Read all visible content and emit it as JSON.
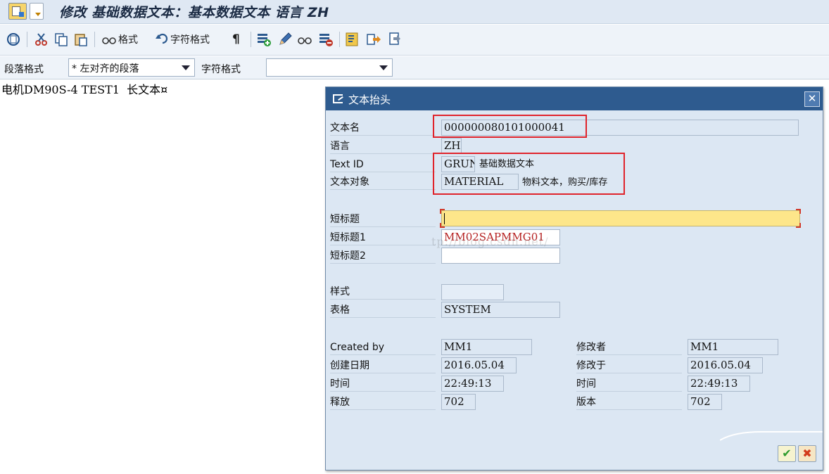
{
  "title": "修改 基础数据文本：基本数据文本 语言 ZH",
  "toolbar": {
    "format_label": "格式",
    "char_format_label": "字符格式",
    "paragraph_mark": "¶"
  },
  "formatbar": {
    "paragraph_label": "段落格式",
    "paragraph_value": "* 左对齐的段落",
    "char_label": "字符格式",
    "char_value": ""
  },
  "editor": {
    "line1": "电机DM90S-4 TEST1  长文本¤"
  },
  "dialog": {
    "title": "文本抬头",
    "close": "✕",
    "fields": {
      "text_name_label": "文本名",
      "text_name_value": "000000080101000041",
      "language_label": "语言",
      "language_value": "ZH",
      "text_id_label": "Text ID",
      "text_id_value": "GRUN",
      "text_id_desc": "基础数据文本",
      "text_object_label": "文本对象",
      "text_object_value": "MATERIAL",
      "text_object_desc": "物料文本，购买/库存",
      "short_title_label": "短标题",
      "short_title_value": "",
      "short_title1_label": "短标题1",
      "short_title1_value": "MM02SAPMMG01",
      "short_title2_label": "短标题2",
      "short_title2_value": "",
      "style_label": "样式",
      "style_value": "",
      "form_label": "表格",
      "form_value": "SYSTEM",
      "created_by_label": "Created by",
      "created_by_value": "MM1",
      "created_date_label": "创建日期",
      "created_date_value": "2016.05.04",
      "created_time_label": "时间",
      "created_time_value": "22:49:13",
      "release_label": "释放",
      "release_value": "702",
      "changed_by_label": "修改者",
      "changed_by_value": "MM1",
      "changed_date_label": "修改于",
      "changed_date_value": "2016.05.04",
      "changed_time_label": "时间",
      "changed_time_value": "22:49:13",
      "version_label": "版本",
      "version_value": "702"
    },
    "ok": "✔",
    "cancel": "✖"
  },
  "watermark": "tp://blog.csdn.net/",
  "colors": {
    "title_bar": "#2e5b8f",
    "highlight": "#e0232b",
    "active_field": "#fde68a"
  }
}
